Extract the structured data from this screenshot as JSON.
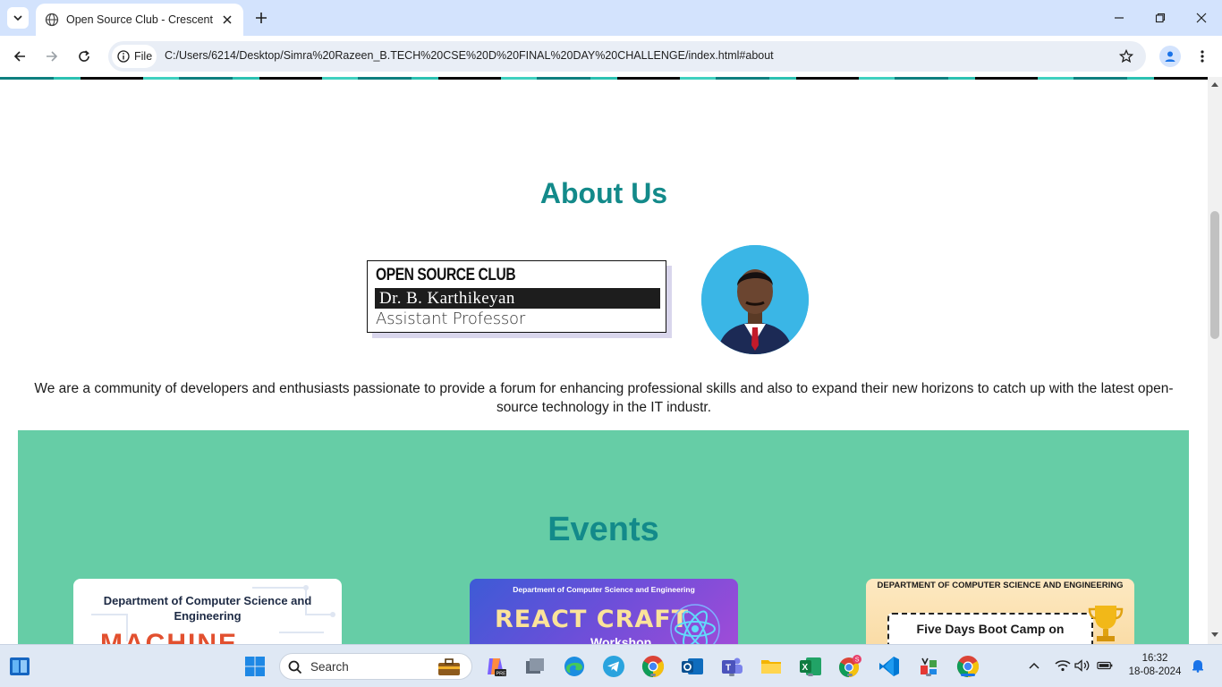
{
  "browser": {
    "tab_title": "Open Source Club - Crescent C",
    "site_chip_label": "File",
    "url": "C:/Users/6214/Desktop/Simra%20Razeen_B.TECH%20CSE%20D%20FINAL%20DAY%20CHALLENGE/index.html#about"
  },
  "about": {
    "heading": "About Us",
    "card": {
      "club": "OPEN SOURCE CLUB",
      "name": "Dr. B. Karthikeyan",
      "role": "Assistant Professor"
    },
    "description": "We are a community of developers and enthusiasts passionate to provide a forum for enhancing professional skills and also to expand their new horizons to catch up with the latest open-source technology in the IT industr."
  },
  "events": {
    "heading": "Events",
    "cards": [
      {
        "dept": "Department of Computer Science and Engineering",
        "title": "MACHINE"
      },
      {
        "dept": "Department of Computer Science and Engineering",
        "title": "REACT CRAFT",
        "subtitle": "Workshop"
      },
      {
        "dept": "DEPARTMENT OF COMPUTER SCIENCE AND ENGINEERING",
        "title": "Five Days Boot Camp on"
      }
    ]
  },
  "taskbar": {
    "search_label": "Search",
    "time": "16:32",
    "date": "18-08-2024",
    "apps": [
      "windows-start",
      "search",
      "work-folder",
      "copilot",
      "file-manager",
      "edge",
      "telegram",
      "chrome",
      "outlook",
      "teams",
      "file-explorer",
      "excel",
      "chrome-profile",
      "vscode",
      "app-games",
      "chrome-active"
    ]
  },
  "colors": {
    "accent_teal": "#138a8a",
    "events_bg": "#66cda6",
    "tab_bar": "#d3e3fd"
  }
}
